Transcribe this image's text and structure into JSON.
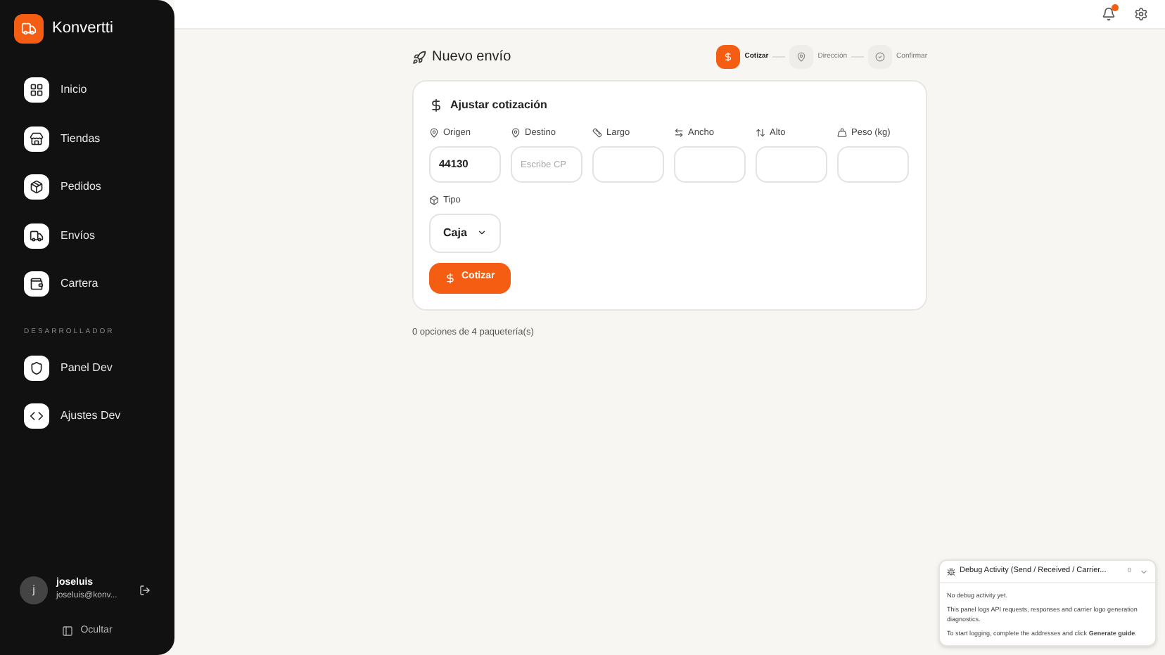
{
  "brand": "Konvertti",
  "nav": [
    {
      "label": "Inicio",
      "selected": false
    },
    {
      "label": "Tiendas",
      "selected": false
    },
    {
      "label": "Pedidos",
      "selected": false
    },
    {
      "label": "Envíos",
      "selected": false
    },
    {
      "label": "Cartera",
      "selected": false
    }
  ],
  "dev_section": {
    "title": "DESARROLLADOR",
    "items": [
      {
        "label": "Panel Dev",
        "selected": false
      },
      {
        "label": "Ajustes Dev",
        "selected": false
      }
    ]
  },
  "user": {
    "initial": "j",
    "name": "joseluis",
    "email": "joseluis@konv..."
  },
  "hide_label": "Ocultar",
  "notifications": {
    "unread": true
  },
  "page_title": "Nuevo envío",
  "steps": [
    {
      "label": "Cotizar",
      "selected": true
    },
    {
      "label": "Dirección",
      "selected": false
    },
    {
      "label": "Confirmar",
      "selected": false
    }
  ],
  "quote_card": {
    "title": "Ajustar cotización",
    "fields": [
      {
        "kind": "input",
        "label": "Origen",
        "value": "44130"
      },
      {
        "kind": "input",
        "label": "Destino",
        "placeholder": "Escribe CP"
      },
      {
        "kind": "input",
        "label": "Largo"
      },
      {
        "kind": "input",
        "label": "Ancho"
      },
      {
        "kind": "input",
        "label": "Alto"
      },
      {
        "kind": "input",
        "label": "Peso (kg)"
      },
      {
        "kind": "select",
        "label": "Tipo",
        "value": "Caja"
      }
    ],
    "button": "Cotizar"
  },
  "results_summary": "0 opciones de 4 paquetería(s)",
  "debug_panel": {
    "title": "Debug Activity (Send / Received / Carrier...",
    "count": "0",
    "expanded": true,
    "lines": [
      "No debug activity yet.",
      "This panel logs API requests, responses and carrier logo generation diagnostics.",
      "To start logging, complete the addresses and click **Generate guide**."
    ]
  }
}
